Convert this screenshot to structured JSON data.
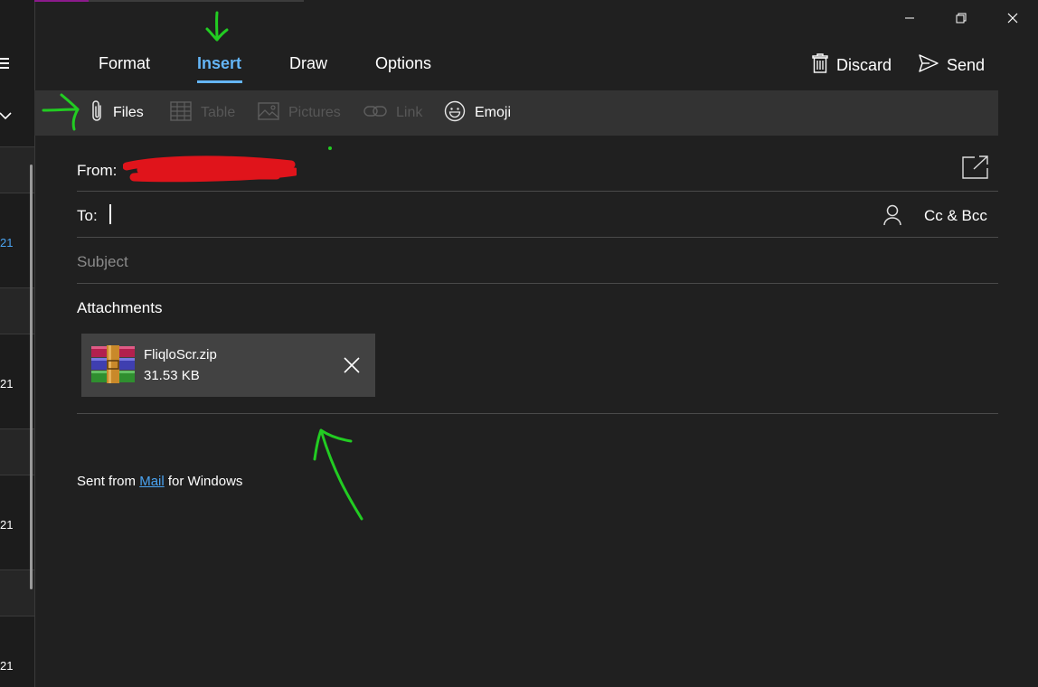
{
  "left_pane": {
    "dates": [
      "21",
      "21",
      "21",
      "21"
    ]
  },
  "tabs": [
    {
      "label": "Format"
    },
    {
      "label": "Insert"
    },
    {
      "label": "Draw"
    },
    {
      "label": "Options"
    }
  ],
  "actions": {
    "discard_label": "Discard",
    "send_label": "Send"
  },
  "toolbar": {
    "files_label": "Files",
    "table_label": "Table",
    "pictures_label": "Pictures",
    "link_label": "Link",
    "emoji_label": "Emoji"
  },
  "compose": {
    "from_label": "From:",
    "to_label": "To:",
    "cc_bcc_label": "Cc & Bcc",
    "subject_placeholder": "Subject",
    "attachments_label": "Attachments"
  },
  "attachment": {
    "name": "FliqloScr.zip",
    "size": "31.53 KB"
  },
  "signature": {
    "prefix": "Sent from ",
    "link": "Mail",
    "suffix": " for Windows"
  },
  "colors": {
    "background": "#202020",
    "toolbar": "#333333",
    "accent": "#64b5f6",
    "annotation": "#22cc22",
    "redaction": "#e0141b"
  },
  "icons": [
    "hamburger-icon",
    "chevron-down-icon",
    "minimize-icon",
    "restore-icon",
    "close-icon",
    "trash-icon",
    "send-icon",
    "paperclip-icon",
    "table-icon",
    "picture-icon",
    "link-icon",
    "emoji-icon",
    "popout-icon",
    "person-icon",
    "rar-archive-icon",
    "remove-icon"
  ]
}
